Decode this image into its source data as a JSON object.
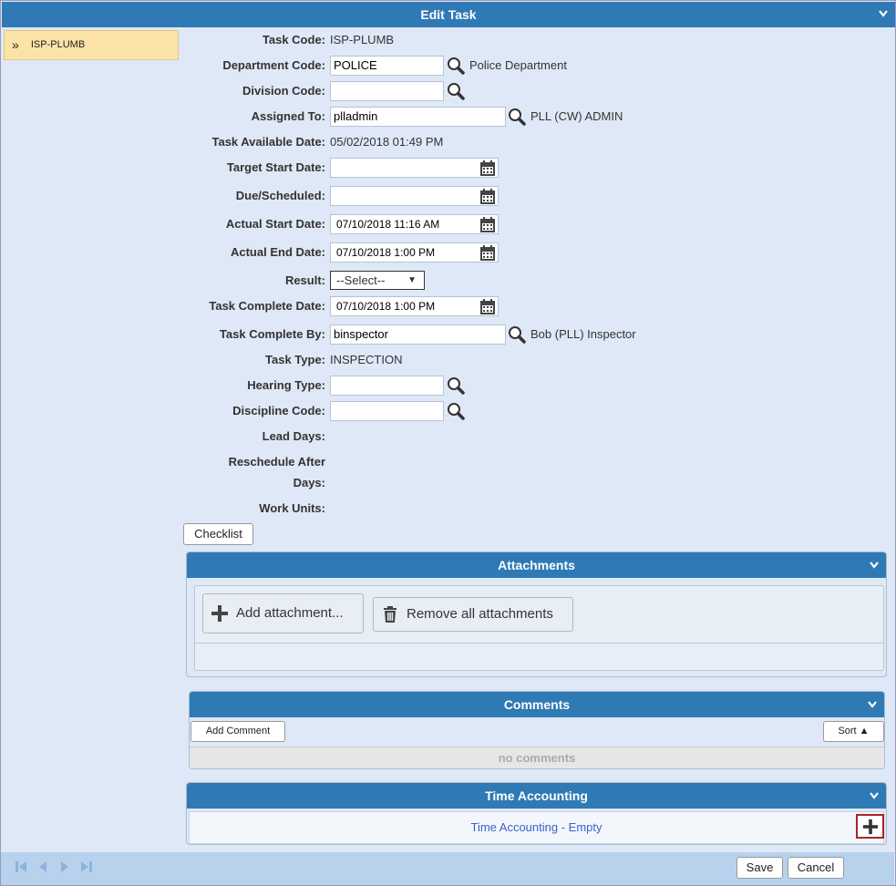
{
  "header": {
    "title": "Edit Task"
  },
  "sidebar": {
    "items": [
      {
        "label": "ISP-PLUMB"
      }
    ]
  },
  "form": {
    "task_code": {
      "label": "Task Code:",
      "value": "ISP-PLUMB"
    },
    "department_code": {
      "label": "Department Code:",
      "value": "POLICE",
      "description": "Police Department"
    },
    "division_code": {
      "label": "Division Code:",
      "value": ""
    },
    "assigned_to": {
      "label": "Assigned To:",
      "value": "plladmin",
      "description": "PLL (CW) ADMIN"
    },
    "task_available_date": {
      "label": "Task Available Date:",
      "value": "05/02/2018 01:49 PM"
    },
    "target_start_date": {
      "label": "Target Start Date:",
      "value": ""
    },
    "due_scheduled": {
      "label": "Due/Scheduled:",
      "value": ""
    },
    "actual_start_date": {
      "label": "Actual Start Date:",
      "value": "07/10/2018 11:16 AM"
    },
    "actual_end_date": {
      "label": "Actual End Date:",
      "value": "07/10/2018 1:00 PM"
    },
    "result": {
      "label": "Result:",
      "value": "--Select--"
    },
    "task_complete_date": {
      "label": "Task Complete Date:",
      "value": "07/10/2018 1:00 PM"
    },
    "task_complete_by": {
      "label": "Task Complete By:",
      "value": "binspector",
      "description": "Bob (PLL) Inspector"
    },
    "task_type": {
      "label": "Task Type:",
      "value": "INSPECTION"
    },
    "hearing_type": {
      "label": "Hearing Type:",
      "value": ""
    },
    "discipline_code": {
      "label": "Discipline Code:",
      "value": ""
    },
    "lead_days": {
      "label": "Lead Days:"
    },
    "reschedule_after_days": {
      "label_line1": "Reschedule After",
      "label_line2": "Days:"
    },
    "work_units": {
      "label": "Work Units:"
    }
  },
  "checklist_button": "Checklist",
  "attachments": {
    "title": "Attachments",
    "add_label": "Add attachment...",
    "remove_label": "Remove all attachments"
  },
  "comments": {
    "title": "Comments",
    "add_label": "Add Comment",
    "sort_label": "Sort ▲",
    "empty_text": "no comments"
  },
  "time_accounting": {
    "title": "Time Accounting",
    "empty_text": "Time Accounting - Empty"
  },
  "footer": {
    "save_label": "Save",
    "cancel_label": "Cancel"
  },
  "colors": {
    "header_blue": "#2f7ab5",
    "background": "#dfe8f6",
    "selected_item": "#fbe3a8",
    "link_blue": "#3a5fc8"
  }
}
